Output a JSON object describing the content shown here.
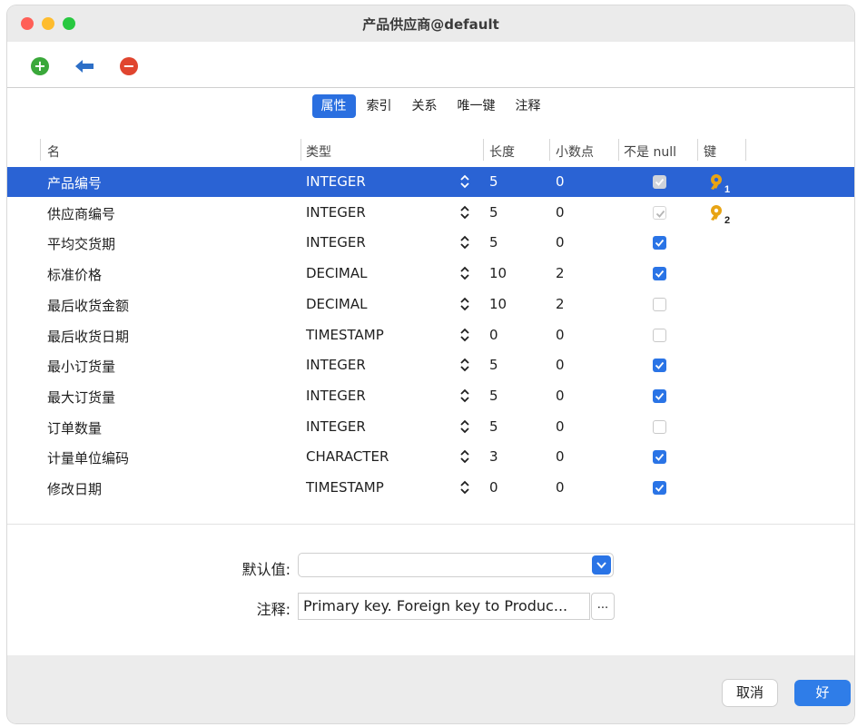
{
  "window": {
    "title": "产品供应商@default"
  },
  "toolbar": {
    "add_label": "+",
    "remove_label": "−"
  },
  "tabs": [
    "属性",
    "索引",
    "关系",
    "唯一键",
    "注释"
  ],
  "columns": {
    "name": "名",
    "type": "类型",
    "length": "长度",
    "decimals": "小数点",
    "not_null": "不是 null",
    "key": "键"
  },
  "rows": [
    {
      "name": "产品编号",
      "type": "INTEGER",
      "length": "5",
      "decimals": "0",
      "not_null": "ghost",
      "key": "1",
      "selected": true
    },
    {
      "name": "供应商编号",
      "type": "INTEGER",
      "length": "5",
      "decimals": "0",
      "not_null": "disabled-on",
      "key": "2"
    },
    {
      "name": "平均交货期",
      "type": "INTEGER",
      "length": "5",
      "decimals": "0",
      "not_null": "on"
    },
    {
      "name": "标准价格",
      "type": "DECIMAL",
      "length": "10",
      "decimals": "2",
      "not_null": "on"
    },
    {
      "name": "最后收货金额",
      "type": "DECIMAL",
      "length": "10",
      "decimals": "2",
      "not_null": "off"
    },
    {
      "name": "最后收货日期",
      "type": "TIMESTAMP",
      "length": "0",
      "decimals": "0",
      "not_null": "off"
    },
    {
      "name": "最小订货量",
      "type": "INTEGER",
      "length": "5",
      "decimals": "0",
      "not_null": "on"
    },
    {
      "name": "最大订货量",
      "type": "INTEGER",
      "length": "5",
      "decimals": "0",
      "not_null": "on"
    },
    {
      "name": "订单数量",
      "type": "INTEGER",
      "length": "5",
      "decimals": "0",
      "not_null": "off"
    },
    {
      "name": "计量单位编码",
      "type": "CHARACTER",
      "length": "3",
      "decimals": "0",
      "not_null": "on"
    },
    {
      "name": "修改日期",
      "type": "TIMESTAMP",
      "length": "0",
      "decimals": "0",
      "not_null": "on"
    }
  ],
  "form": {
    "default_label": "默认值:",
    "default_value": "",
    "comment_label": "注释:",
    "comment_value": "Primary key. Foreign key to Produc...",
    "more_label": "..."
  },
  "footer": {
    "cancel_label": "取消",
    "ok_label": "好"
  },
  "colors": {
    "accent": "#2a74e6",
    "selection": "#2a63d4",
    "key_gold": "#e8a414"
  }
}
